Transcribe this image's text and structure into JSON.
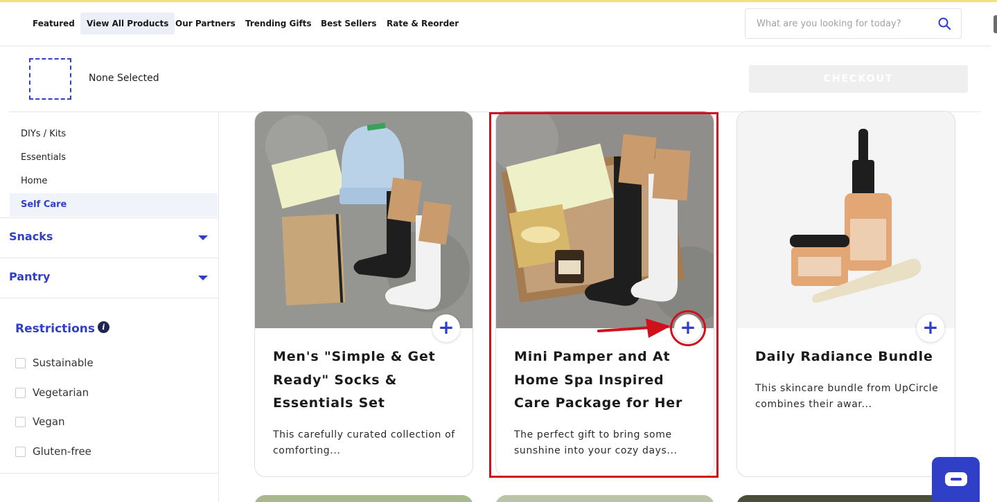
{
  "nav": {
    "items": [
      {
        "label": "Featured"
      },
      {
        "label": "View All Products"
      },
      {
        "label": "Our Partners"
      },
      {
        "label": "Trending Gifts"
      },
      {
        "label": "Best Sellers"
      },
      {
        "label": "Rate & Reorder"
      }
    ],
    "active_item": "View All Products",
    "search_placeholder": "What are you looking for today?"
  },
  "selection": {
    "status": "None Selected",
    "checkout_label": "CHECKOUT"
  },
  "sidebar": {
    "subcategories": [
      {
        "label": "DIYs / Kits"
      },
      {
        "label": "Essentials"
      },
      {
        "label": "Home"
      },
      {
        "label": "Self Care"
      }
    ],
    "active_subcategory": "Self Care",
    "categories": [
      {
        "label": "Snacks"
      },
      {
        "label": "Pantry"
      }
    ],
    "restrictions": {
      "title": "Restrictions",
      "info_icon_glyph": "i",
      "options": [
        {
          "label": "Sustainable",
          "checked": false
        },
        {
          "label": "Vegetarian",
          "checked": false
        },
        {
          "label": "Vegan",
          "checked": false
        },
        {
          "label": "Gluten-free",
          "checked": false
        }
      ]
    }
  },
  "products": [
    {
      "title": "Men's \"Simple & Get Ready\" Socks & Essentials Set",
      "description": "This carefully curated collection of comforting...",
      "add_glyph": "+"
    },
    {
      "title": "Mini Pamper and At Home Spa Inspired Care Package for Her",
      "description": "The perfect gift to bring some sunshine into your cozy days...",
      "add_glyph": "+"
    },
    {
      "title": "Daily Radiance Bundle",
      "description": "This skincare bundle from UpCircle combines their awar...",
      "add_glyph": "+"
    }
  ],
  "colors": {
    "accent": "#2f3fc7",
    "annotation_red": "#d0101a",
    "top_line": "#f7dd7a"
  },
  "icons": {
    "search": "search-icon",
    "caret": "caret-down-icon",
    "info": "info-icon",
    "chat": "chat-icon",
    "add": "plus-icon",
    "arrow": "arrow-right-icon"
  }
}
